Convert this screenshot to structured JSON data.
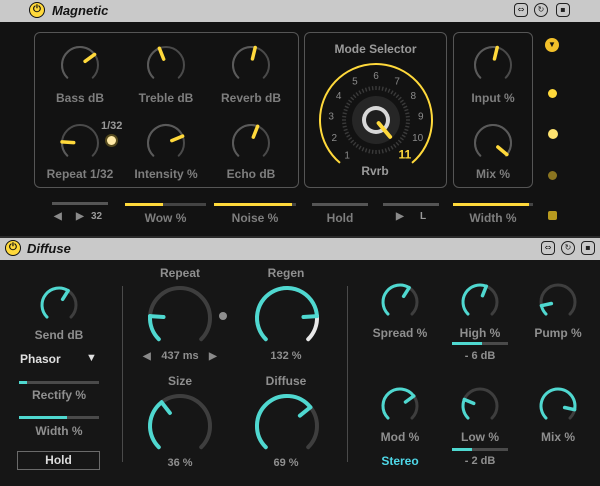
{
  "colors": {
    "yellow": "#ffd93b",
    "cyan": "#4fd8d0",
    "white": "#e8e8e8"
  },
  "magnetic": {
    "title": "Magnetic",
    "power_icon": "power-icon",
    "header_icons": [
      "link-icon",
      "reset-icon",
      "save-icon"
    ],
    "knobs": [
      {
        "id": "bass",
        "label": "Bass dB",
        "value": 0.7
      },
      {
        "id": "treble",
        "label": "Treble dB",
        "value": 0.42
      },
      {
        "id": "reverb",
        "label": "Reverb dB",
        "value": 0.55
      },
      {
        "id": "repeat",
        "label": "Repeat 1/32",
        "value": 0.18
      },
      {
        "id": "intensity",
        "label": "Intensity %",
        "value": 0.75
      },
      {
        "id": "echo",
        "label": "Echo dB",
        "value": 0.58
      },
      {
        "id": "input",
        "label": "Input %",
        "value": 0.55
      },
      {
        "id": "mix",
        "label": "Mix %",
        "value": 0.98
      }
    ],
    "repeat_tag": "1/32",
    "mode": {
      "title": "Mode Selector",
      "numbers": [
        "1",
        "2",
        "3",
        "4",
        "5",
        "6",
        "7",
        "8",
        "9",
        "10",
        "11"
      ],
      "label": "Rvrb",
      "value": "11"
    },
    "bottom": {
      "stepper_value": "32",
      "wow": "Wow %",
      "noise": "Noise %",
      "hold": "Hold",
      "play_letter": "L",
      "width": "Width %"
    },
    "side_controls": [
      "dropdown-arrow-icon",
      "led-1",
      "led-2",
      "led-3",
      "square-led"
    ]
  },
  "diffuse": {
    "title": "Diffuse",
    "power_icon": "power-icon",
    "header_icons": [
      "link-icon",
      "reset-icon",
      "save-icon"
    ],
    "send": {
      "label": "Send dB",
      "value": 0.62
    },
    "waveform": "Phasor",
    "rectify": {
      "label": "Rectify %",
      "value": 0.1
    },
    "width": {
      "label": "Width %",
      "value": 0.6
    },
    "hold": "Hold",
    "repeat": {
      "label": "Repeat",
      "value": 0.18,
      "readout": "437 ms"
    },
    "regen": {
      "label": "Regen",
      "value": 0.82,
      "readout": "132 %"
    },
    "size": {
      "label": "Size",
      "value": 0.36,
      "readout": "36 %"
    },
    "diffuse_knob": {
      "label": "Diffuse",
      "value": 0.69,
      "readout": "69 %"
    },
    "spread": {
      "label": "Spread %",
      "value": 0.62
    },
    "high": {
      "label": "High %",
      "value": 0.58,
      "sub": "- 6 dB"
    },
    "pump": {
      "label": "Pump %",
      "value": 0.12
    },
    "mod": {
      "label": "Mod %",
      "value": 0.7
    },
    "low": {
      "label": "Low %",
      "value": 0.25,
      "sub": "- 2 dB"
    },
    "mix": {
      "label": "Mix %",
      "value": 0.88
    },
    "stereo": "Stereo"
  }
}
